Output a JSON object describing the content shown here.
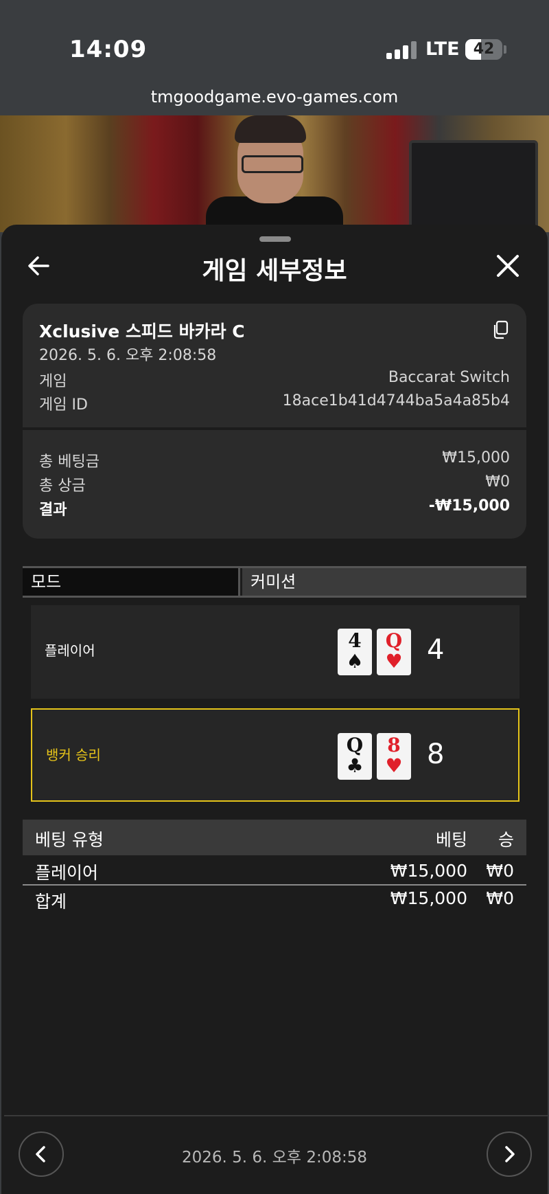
{
  "status_bar": {
    "time": "14:09",
    "network": "LTE",
    "battery": "42",
    "battery_level": 0.42
  },
  "browser": {
    "url": "tmgoodgame.evo-games.com"
  },
  "sheet": {
    "title": "게임 세부정보"
  },
  "details": {
    "game_name": "Xclusive 스피드 바카라 C",
    "datetime": "2026. 5. 6. 오후 2:08:58",
    "rows": [
      {
        "label": "게임",
        "value": "Baccarat Switch"
      },
      {
        "label": "게임 ID",
        "value": "18ace1b41d4744ba5a4a85b4"
      }
    ],
    "totals": [
      {
        "label": "총 베팅금",
        "value": "₩15,000"
      },
      {
        "label": "총 상금",
        "value": "₩0"
      },
      {
        "label": "결과",
        "value": "-₩15,000"
      }
    ]
  },
  "tabs": {
    "mode": "모드",
    "commission": "커미션"
  },
  "hands": [
    {
      "label": "플레이어",
      "cards": [
        {
          "rank": "4",
          "suit": "♠",
          "color": "black"
        },
        {
          "rank": "Q",
          "suit": "♥",
          "color": "red"
        }
      ],
      "score": "4"
    },
    {
      "label": "뱅커 승리",
      "cards": [
        {
          "rank": "Q",
          "suit": "♣",
          "color": "black"
        },
        {
          "rank": "8",
          "suit": "♥",
          "color": "red"
        }
      ],
      "score": "8"
    }
  ],
  "bets": {
    "headers": {
      "type": "베팅 유형",
      "bet": "베팅",
      "win": "승"
    },
    "rows": [
      {
        "type": "플레이어",
        "bet": "₩15,000",
        "win": "₩0"
      }
    ],
    "total": {
      "type": "합계",
      "bet": "₩15,000",
      "win": "₩0"
    }
  },
  "footer": {
    "datetime": "2026. 5. 6. 오후 2:08:58"
  },
  "colors": {
    "sheet_bg": "#1c1c1c",
    "winner_accent": "#e5c41a",
    "red_suit": "#e0202a"
  },
  "icons": {
    "back": "arrow-left-icon",
    "close": "close-icon",
    "copy": "copy-icon",
    "prev": "chevron-left-icon",
    "next": "chevron-right-icon"
  }
}
